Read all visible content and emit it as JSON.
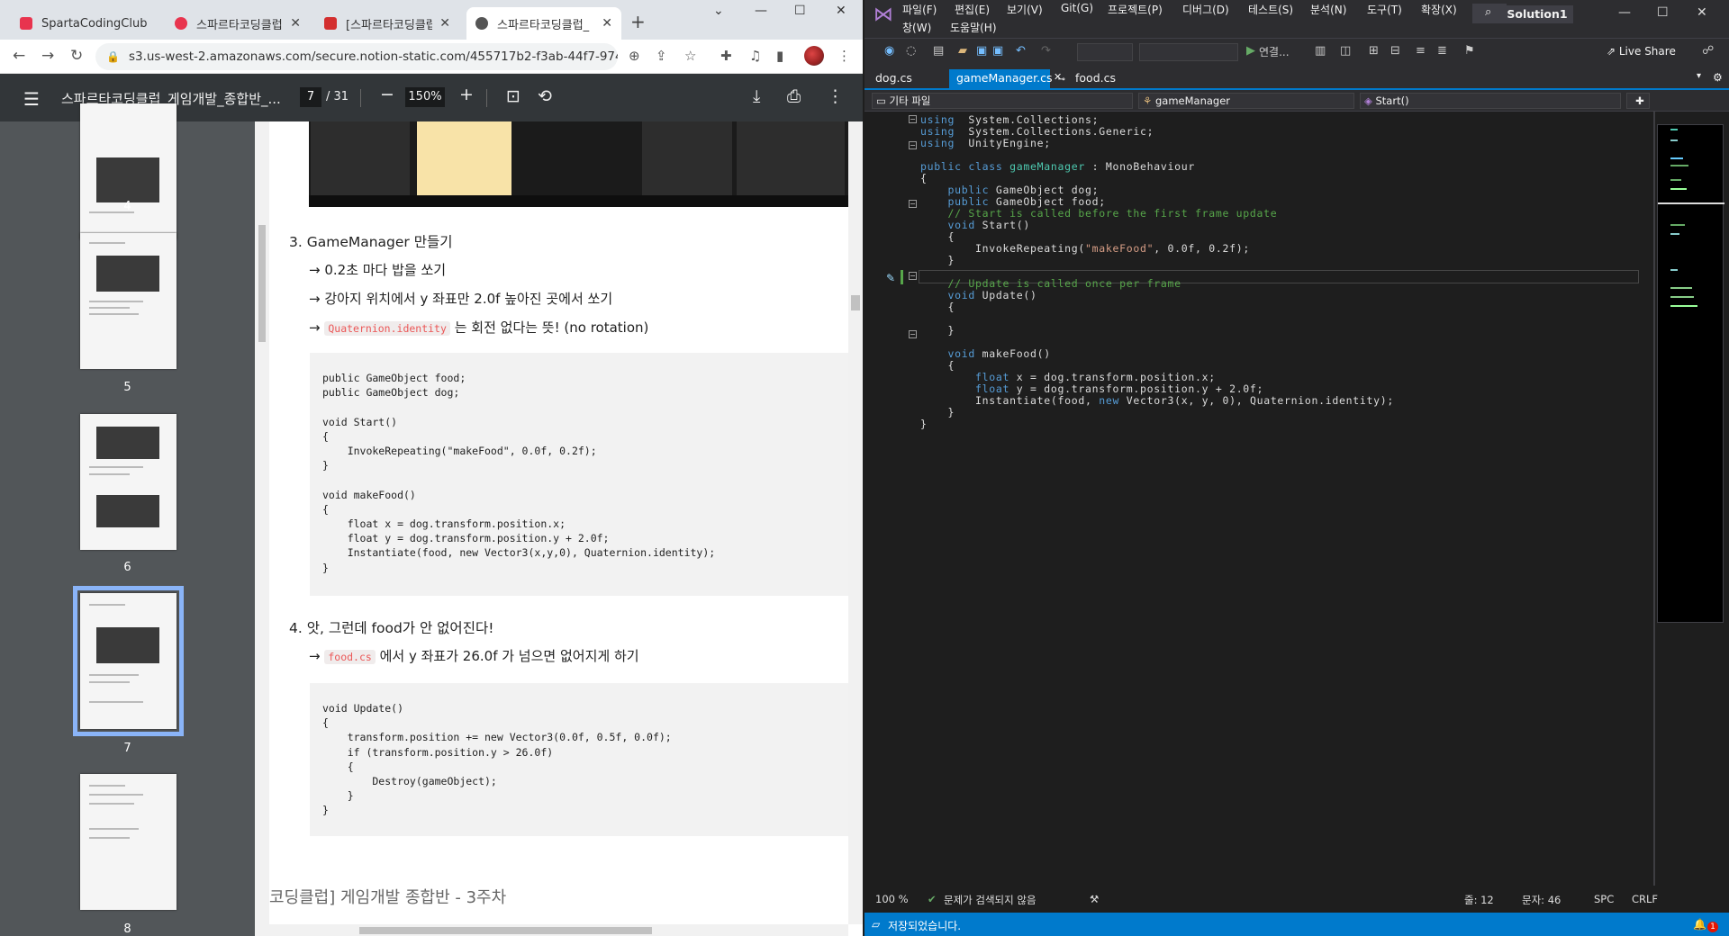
{
  "browser": {
    "tabs": [
      {
        "label": "SpartaCodingClub",
        "color": "#e8344e"
      },
      {
        "label": "스파르타코딩클럽",
        "color": "#e8344e"
      },
      {
        "label": "[스파르타코딩클럽]",
        "color": "#d32f2f"
      },
      {
        "label": "스파르타코딩클럽_",
        "color": "#555555"
      }
    ],
    "url": "s3.us-west-2.amazonaws.com/secure.notion-static.com/455717b2-f3ab-44f7-9742-b..."
  },
  "pdf": {
    "title": "스파르타코딩클럽_게임개발_종합반_...",
    "page": "7",
    "page_total": "/ 31",
    "zoom": "150%",
    "thumbnails": [
      "4",
      "5",
      "6",
      "7",
      "8"
    ],
    "section3": {
      "heading": "3.  GameManager 만들기",
      "bullets": [
        "→ 0.2초 마다 밥을 쏘기",
        "→ 강아지 위치에서 y 좌표만 2.0f 높아진 곳에서 쏘기"
      ],
      "bullet3_arrow": "→",
      "bullet3_code": "Quaternion.identity",
      "bullet3_text": "는 회전 없다는 뜻! (no rotation)",
      "code": "public GameObject food;\npublic GameObject dog;\n\nvoid Start()\n{\n    InvokeRepeating(\"makeFood\", 0.0f, 0.2f);\n}\n\nvoid makeFood()\n{\n    float x = dog.transform.position.x;\n    float y = dog.transform.position.y + 2.0f;\n    Instantiate(food, new Vector3(x,y,0), Quaternion.identity);\n}"
    },
    "section4": {
      "heading": "4.  앗, 그런데 food가 안 없어진다!",
      "bullet_arrow": "→",
      "bullet_code": "food.cs",
      "bullet_text": "에서 y 좌표가 26.0f 가 넘으면 없어지게 하기",
      "code": "void Update()\n{\n    transform.position += new Vector3(0.0f, 0.5f, 0.0f);\n    if (transform.position.y > 26.0f)\n    {\n        Destroy(gameObject);\n    }\n}"
    },
    "footer": "코딩클럽] 게임개발 종합반 - 3주차"
  },
  "vs": {
    "menu": [
      "파일(F)",
      "편집(E)",
      "보기(V)",
      "Git(G)",
      "프로젝트(P)",
      "디버그(D)",
      "테스트(S)",
      "분석(N)",
      "도구(T)",
      "확장(X)"
    ],
    "menu2": [
      "창(W)",
      "도움말(H)"
    ],
    "solution": "Solution1",
    "run_label": "연결...",
    "live_share": "Live Share",
    "doc_tabs": [
      "dog.cs",
      "gameManager.cs",
      "food.cs"
    ],
    "nav": [
      "기타 파일",
      "gameManager",
      "Start()"
    ],
    "status": {
      "zoom": "100 %",
      "issues": "문제가 검색되지 않음",
      "line": "줄: 12",
      "col": "문자: 46",
      "spc": "SPC",
      "crlf": "CRLF",
      "saved": "저장되었습니다.",
      "notify": "1"
    }
  }
}
